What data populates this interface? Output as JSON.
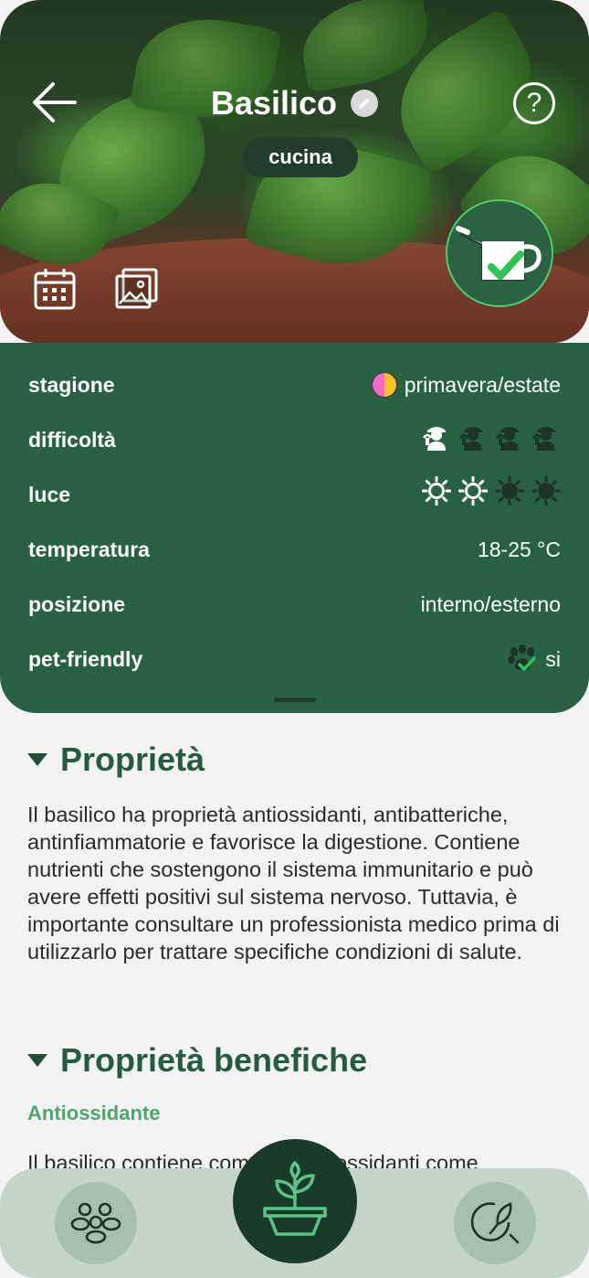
{
  "header": {
    "title": "Basilico",
    "category_tag": "cucina",
    "back_icon": "arrow-left-icon",
    "edit_icon": "pencil-icon",
    "help_icon": "question-circle-icon",
    "calendar_icon": "calendar-icon",
    "gallery_icon": "gallery-icon",
    "water_icon": "watering-can-check-icon"
  },
  "info": {
    "rows": [
      {
        "label": "stagione",
        "value": "primavera/estate",
        "icon": "season-dot-icon"
      },
      {
        "label": "difficoltà",
        "value_level": 1,
        "value_max": 4,
        "icon": "gardener-icon"
      },
      {
        "label": "luce",
        "value_level": 2,
        "value_max": 4,
        "icon": "sun-icon"
      },
      {
        "label": "temperatura",
        "value": "18-25 °C"
      },
      {
        "label": "posizione",
        "value": "interno/esterno"
      },
      {
        "label": "pet-friendly",
        "value": "si",
        "icon": "paw-check-icon"
      }
    ]
  },
  "sections": {
    "properties_title": "Proprietà",
    "properties_text": "Il basilico ha proprietà antiossidanti, antibatteriche, antinfiammatorie e favorisce la digestione. Contiene nutrienti che sostengono il sistema immunitario e può avere effetti positivi sul sistema nervoso. Tuttavia, è importante consultare un professionista medico prima di utilizzarlo per trattare specifiche condizioni di salute.",
    "benefits_title": "Proprietà benefiche",
    "benefits_sub": "Antiossidante",
    "benefits_text": "Il basilico contiene composti antiossidanti come"
  },
  "bottom_nav": {
    "left_icon": "community-icon",
    "center_icon": "plant-pot-icon",
    "right_icon": "plant-search-icon"
  },
  "colors": {
    "panel": "#296243",
    "accent_green": "#4aa86a",
    "title_green": "#255c3f",
    "nav_bg": "#c4d6c8"
  }
}
